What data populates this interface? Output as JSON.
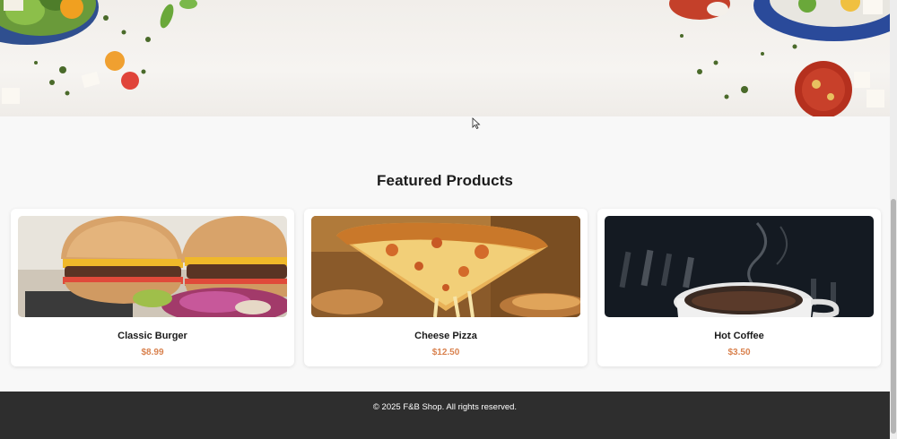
{
  "section": {
    "title": "Featured Products"
  },
  "products": [
    {
      "name": "Classic Burger",
      "price": "$8.99",
      "image": "burger-image"
    },
    {
      "name": "Cheese Pizza",
      "price": "$12.50",
      "image": "pizza-image"
    },
    {
      "name": "Hot Coffee",
      "price": "$3.50",
      "image": "coffee-image"
    }
  ],
  "footer": {
    "copyright": "© 2025 F&B Shop. All rights reserved."
  },
  "colors": {
    "price": "#d9824f",
    "footer_bg": "#2e2e2e",
    "page_bg": "#f8f8f8"
  }
}
